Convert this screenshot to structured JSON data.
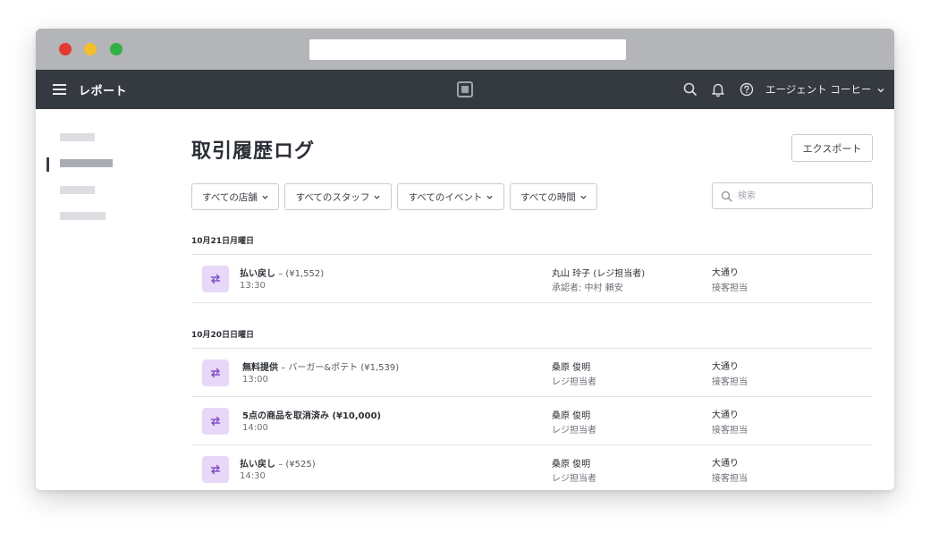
{
  "app": {
    "title": "レポート",
    "account_name": "エージェント コーヒー"
  },
  "colors": {
    "appbar": "#353a41",
    "icon_tile": "#e8d8f8",
    "icon_glyph": "#7c4fc4",
    "traffic_red": "#e23a31",
    "traffic_yellow": "#f3be2c",
    "traffic_green": "#32b043"
  },
  "icons": {
    "menu": "hamburger-icon",
    "logo": "square-logo-icon",
    "search": "search-icon",
    "bell": "bell-icon",
    "help": "help-icon",
    "caret": "chevron-down-icon",
    "row": "swap-arrows-icon"
  },
  "page": {
    "title": "取引履歴ログ",
    "export_label": "エクスポート"
  },
  "filters": [
    {
      "label": "すべての店舗"
    },
    {
      "label": "すべてのスタッフ"
    },
    {
      "label": "すべてのイベント"
    },
    {
      "label": "すべての時間"
    }
  ],
  "search": {
    "placeholder": "検索",
    "value": ""
  },
  "groups": [
    {
      "date": "10月21日月曜日",
      "events": [
        {
          "title": "払い戻し",
          "detail": "– (¥1,552)",
          "time": "13:30",
          "staff": "丸山 玲子 (レジ担当者)",
          "role": "承認者: 中村 頼安",
          "location": "大通り",
          "department": "接客担当"
        }
      ]
    },
    {
      "date": "10月20日日曜日",
      "events": [
        {
          "title": "無料提供",
          "detail": "– バーガー&ポテト (¥1,539)",
          "time": "13:00",
          "staff": "桑原 俊明",
          "role": "レジ担当者",
          "location": "大通り",
          "department": "接客担当"
        },
        {
          "title": "5点の商品を取消済み (¥10,000)",
          "detail": "",
          "time": "14:00",
          "staff": "桑原 俊明",
          "role": "レジ担当者",
          "location": "大通り",
          "department": "接客担当"
        },
        {
          "title": "払い戻し",
          "detail": "– (¥525)",
          "time": "14:30",
          "staff": "桑原 俊明",
          "role": "レジ担当者",
          "location": "大通り",
          "department": "接客担当"
        }
      ]
    }
  ]
}
